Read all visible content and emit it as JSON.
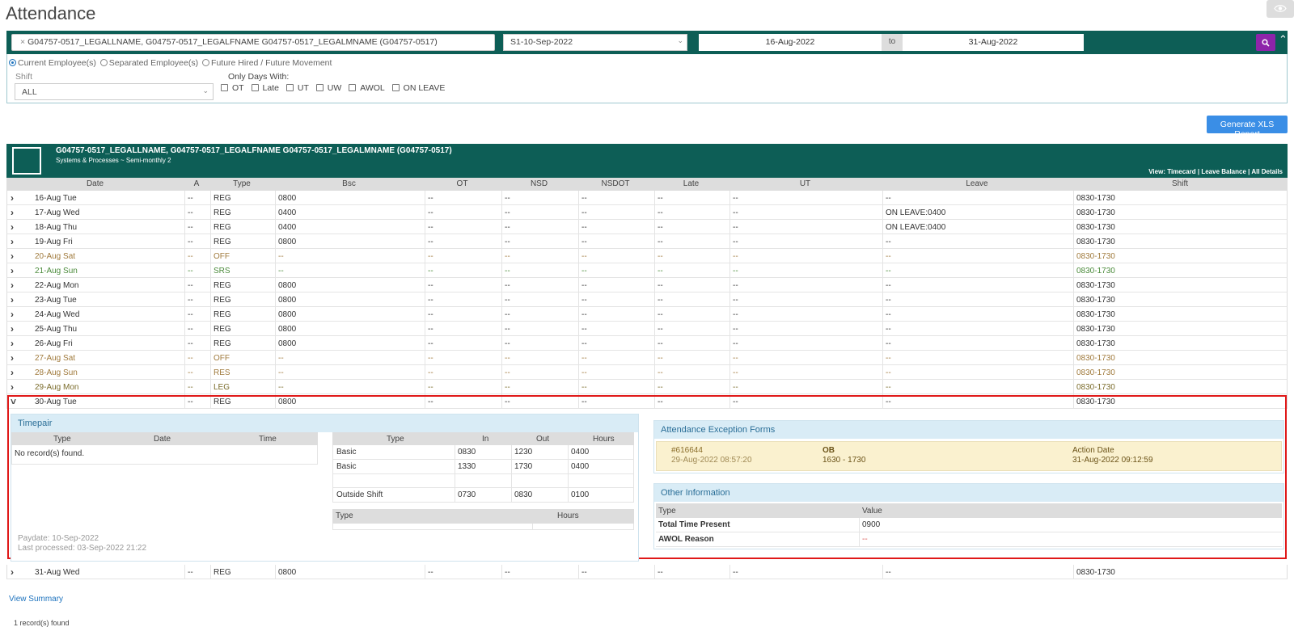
{
  "page": {
    "title": "Attendance"
  },
  "filters": {
    "employee_value": "G04757-0517_LEGALLNAME, G04757-0517_LEGALFNAME G04757-0517_LEGALMNAME (G04757-0517)",
    "payroll_period": "S1-10-Sep-2022",
    "date_from": "16-Aug-2022",
    "to_label": "to",
    "date_to": "31-Aug-2022",
    "radios": [
      "Current Employee(s)",
      "Separated Employee(s)",
      "Future Hired / Future Movement"
    ],
    "shift_label": "Shift",
    "shift_value": "ALL",
    "only_days_label": "Only Days With:",
    "checkboxes": [
      "OT",
      "Late",
      "UT",
      "UW",
      "AWOL",
      "ON LEAVE"
    ]
  },
  "actions": {
    "generate_xls": "Generate XLS Report"
  },
  "employee": {
    "name": "G04757-0517_LEGALLNAME, G04757-0517_LEGALFNAME G04757-0517_LEGALMNAME (G04757-0517)",
    "subtitle": "Systems & Processes ~ Semi-monthly 2",
    "link_timecard": "View: Timecard",
    "link_leave": "Leave Balance",
    "link_all": "All Details",
    "sep": " | "
  },
  "table": {
    "headers": [
      "Date",
      "A",
      "Type",
      "Bsc",
      "OT",
      "NSD",
      "NSDOT",
      "Late",
      "UT",
      "Leave",
      "Shift"
    ],
    "rows": [
      [
        "16-Aug Tue",
        "--",
        "REG",
        "0800",
        "--",
        "--",
        "--",
        "--",
        "--",
        "--",
        "0830-1730"
      ],
      [
        "17-Aug Wed",
        "--",
        "REG",
        "0400",
        "--",
        "--",
        "--",
        "--",
        "--",
        "ON LEAVE:0400",
        "0830-1730"
      ],
      [
        "18-Aug Thu",
        "--",
        "REG",
        "0400",
        "--",
        "--",
        "--",
        "--",
        "--",
        "ON LEAVE:0400",
        "0830-1730"
      ],
      [
        "19-Aug Fri",
        "--",
        "REG",
        "0800",
        "--",
        "--",
        "--",
        "--",
        "--",
        "--",
        "0830-1730"
      ],
      [
        "20-Aug Sat",
        "--",
        "OFF",
        "--",
        "--",
        "--",
        "--",
        "--",
        "--",
        "--",
        "0830-1730"
      ],
      [
        "21-Aug Sun",
        "--",
        "SRS",
        "--",
        "--",
        "--",
        "--",
        "--",
        "--",
        "--",
        "0830-1730"
      ],
      [
        "22-Aug Mon",
        "--",
        "REG",
        "0800",
        "--",
        "--",
        "--",
        "--",
        "--",
        "--",
        "0830-1730"
      ],
      [
        "23-Aug Tue",
        "--",
        "REG",
        "0800",
        "--",
        "--",
        "--",
        "--",
        "--",
        "--",
        "0830-1730"
      ],
      [
        "24-Aug Wed",
        "--",
        "REG",
        "0800",
        "--",
        "--",
        "--",
        "--",
        "--",
        "--",
        "0830-1730"
      ],
      [
        "25-Aug Thu",
        "--",
        "REG",
        "0800",
        "--",
        "--",
        "--",
        "--",
        "--",
        "--",
        "0830-1730"
      ],
      [
        "26-Aug Fri",
        "--",
        "REG",
        "0800",
        "--",
        "--",
        "--",
        "--",
        "--",
        "--",
        "0830-1730"
      ],
      [
        "27-Aug Sat",
        "--",
        "OFF",
        "--",
        "--",
        "--",
        "--",
        "--",
        "--",
        "--",
        "0830-1730"
      ],
      [
        "28-Aug Sun",
        "--",
        "RES",
        "--",
        "--",
        "--",
        "--",
        "--",
        "--",
        "--",
        "0830-1730"
      ],
      [
        "29-Aug Mon",
        "--",
        "LEG",
        "--",
        "--",
        "--",
        "--",
        "--",
        "--",
        "--",
        "0830-1730"
      ],
      [
        "30-Aug Tue",
        "--",
        "REG",
        "0800",
        "--",
        "--",
        "--",
        "--",
        "--",
        "--",
        "0830-1730"
      ]
    ],
    "last_row": [
      "31-Aug Wed",
      "--",
      "REG",
      "0800",
      "--",
      "--",
      "--",
      "--",
      "--",
      "--",
      "0830-1730"
    ]
  },
  "detail": {
    "timepair_title": "Timepair",
    "timepair_headers": [
      "Type",
      "Date",
      "Time"
    ],
    "timepair_empty": "No record(s) found.",
    "hours_headers": [
      "Type",
      "In",
      "Out",
      "Hours"
    ],
    "hours_rows": [
      [
        "Basic",
        "0830",
        "1230",
        "0400"
      ],
      [
        "Basic",
        "1330",
        "1730",
        "0400"
      ],
      [
        "",
        "",
        "",
        ""
      ],
      [
        "Outside Shift",
        "0730",
        "0830",
        "0100"
      ]
    ],
    "type_hours_headers": [
      "Type",
      "Hours"
    ],
    "paydate": "Paydate: 10-Sep-2022",
    "last_processed": "Last processed: 03-Sep-2022 21:22",
    "exception_title": "Attendance Exception Forms",
    "exception": {
      "id": "#616644",
      "created": "29-Aug-2022 08:57:20",
      "type": "OB",
      "time": "1630 - 1730",
      "action_label": "Action Date",
      "action_date": "31-Aug-2022 09:12:59"
    },
    "other_title": "Other Information",
    "other_headers": [
      "Type",
      "Value"
    ],
    "other_rows": [
      [
        "Total Time Present",
        "0900"
      ],
      [
        "AWOL Reason",
        "--"
      ]
    ]
  },
  "footer": {
    "view_summary": "View Summary",
    "records_found": "1 record(s) found"
  }
}
